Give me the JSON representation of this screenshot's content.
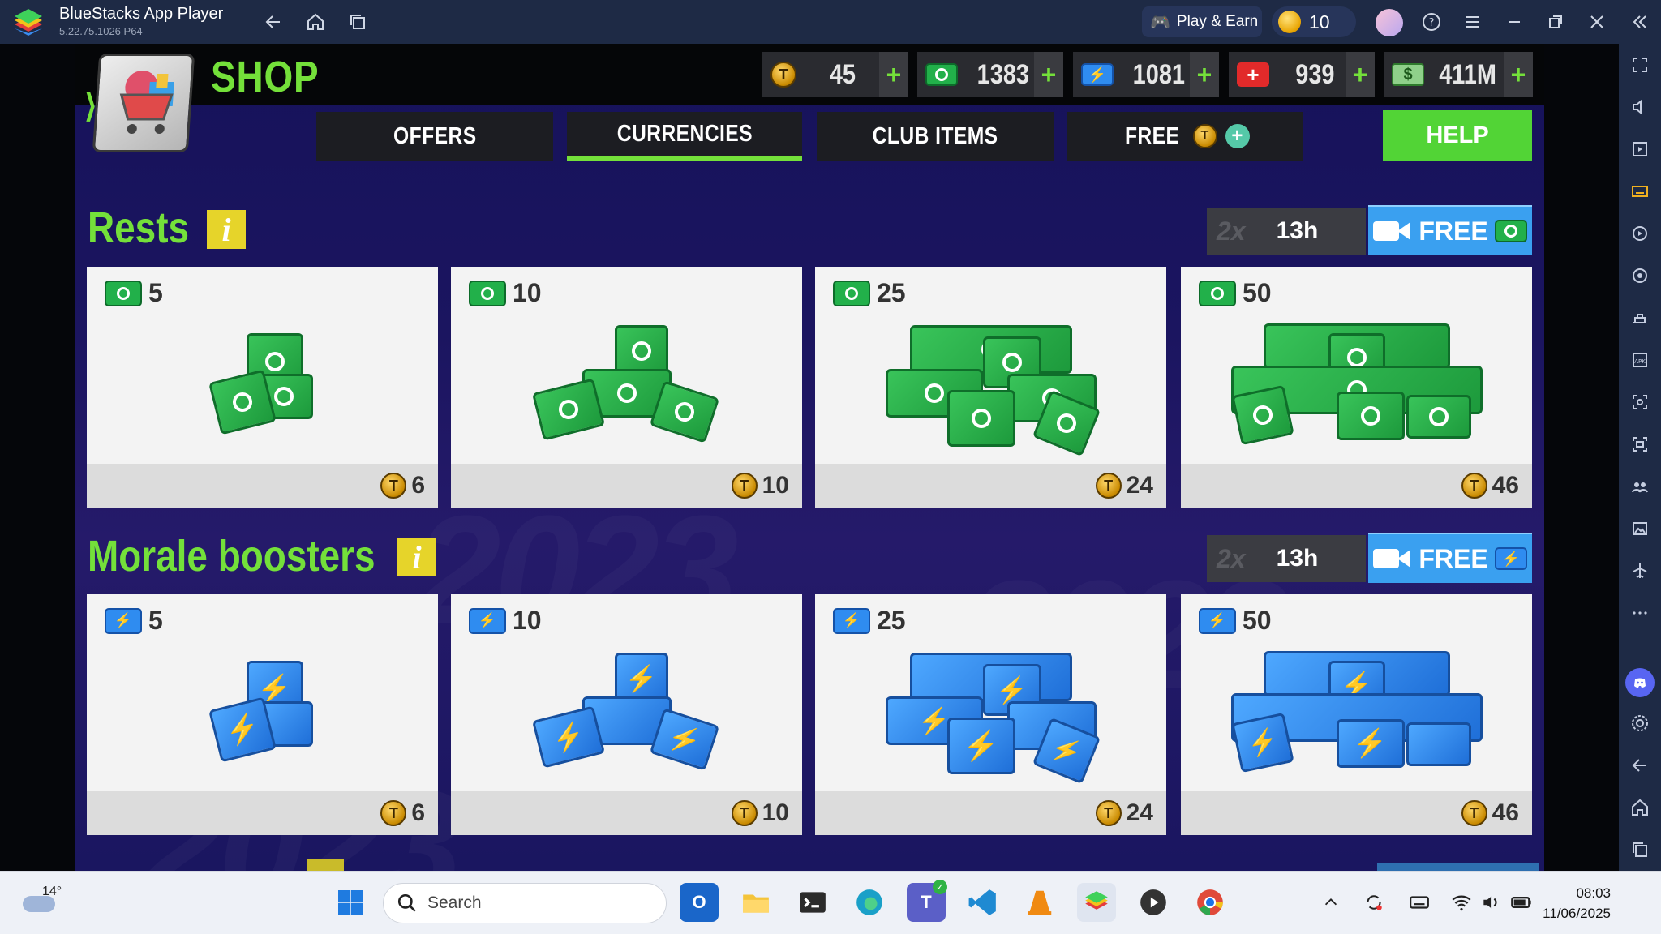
{
  "window": {
    "title": "BlueStacks App Player",
    "version": "5.22.75.1026  P64",
    "play_earn": "Play & Earn",
    "coins": "10"
  },
  "shop": {
    "title": "SHOP",
    "help": "HELP",
    "currencies": {
      "tokens": "45",
      "rests": "1383",
      "boosters": "1081",
      "medical": "939",
      "cash": "411M"
    },
    "tabs": [
      {
        "label": "OFFERS"
      },
      {
        "label": "CURRENCIES"
      },
      {
        "label": "CLUB ITEMS"
      },
      {
        "label": "FREE"
      }
    ],
    "active_tab": "CURRENCIES",
    "sections": [
      {
        "title": "Rests",
        "multiplier": "2x",
        "timer": "13h",
        "free_label": "FREE",
        "items": [
          {
            "qty": "5",
            "price": "6"
          },
          {
            "qty": "10",
            "price": "10"
          },
          {
            "qty": "25",
            "price": "24"
          },
          {
            "qty": "50",
            "price": "46"
          }
        ]
      },
      {
        "title": "Morale boosters",
        "multiplier": "2x",
        "timer": "13h",
        "free_label": "FREE",
        "items": [
          {
            "qty": "5",
            "price": "6"
          },
          {
            "qty": "10",
            "price": "10"
          },
          {
            "qty": "25",
            "price": "24"
          },
          {
            "qty": "50",
            "price": "46"
          }
        ]
      }
    ]
  },
  "coin_symbol": "T",
  "taskbar": {
    "temperature": "14°",
    "search_placeholder": "Search",
    "time": "08:03",
    "date": "11/06/2025"
  },
  "colors": {
    "accent_green": "#74e03a",
    "free_blue": "#3aa0f0",
    "help_green": "#52d436"
  }
}
